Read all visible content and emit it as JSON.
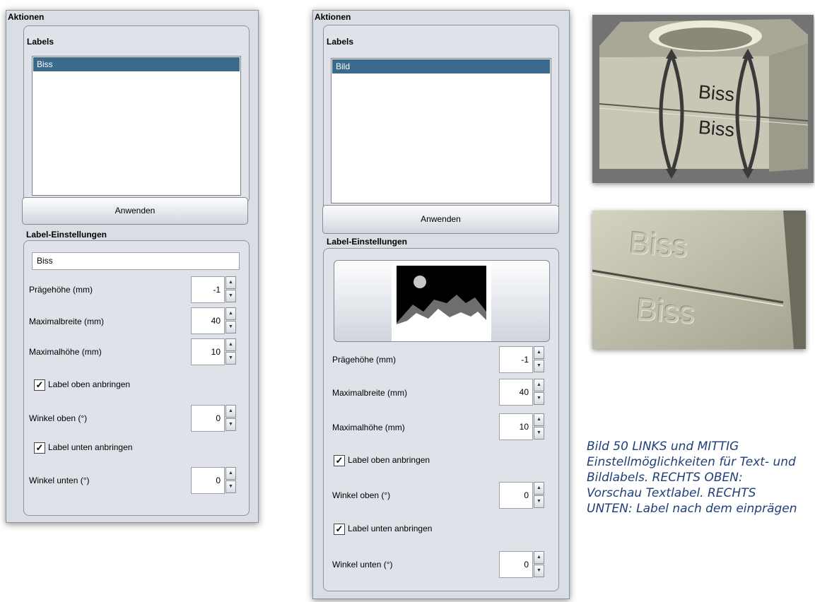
{
  "left_panel": {
    "title": "Aktionen",
    "labels_group_title": "Labels",
    "list_items": [
      "Biss"
    ],
    "apply_button": "Anwenden",
    "settings_title": "Label-Einstellungen",
    "text_value": "Biss",
    "emboss_height_label": "Prägehöhe (mm)",
    "emboss_height_value": "-1",
    "max_width_label": "Maximalbreite (mm)",
    "max_width_value": "40",
    "max_height_label": "Maximalhöhe (mm)",
    "max_height_value": "10",
    "label_top_checkbox": "Label oben anbringen",
    "angle_top_label": "Winkel oben (°)",
    "angle_top_value": "0",
    "label_bottom_checkbox": "Label unten anbringen",
    "angle_bottom_label": "Winkel unten (°)",
    "angle_bottom_value": "0"
  },
  "middle_panel": {
    "title": "Aktionen",
    "labels_group_title": "Labels",
    "list_items": [
      "Bild"
    ],
    "apply_button": "Anwenden",
    "settings_title": "Label-Einstellungen",
    "emboss_height_label": "Prägehöhe (mm)",
    "emboss_height_value": "-1",
    "max_width_label": "Maximalbreite (mm)",
    "max_width_value": "40",
    "max_height_label": "Maximalhöhe (mm)",
    "max_height_value": "10",
    "label_top_checkbox": "Label oben anbringen",
    "angle_top_label": "Winkel oben (°)",
    "angle_top_value": "0",
    "label_bottom_checkbox": "Label unten anbringen",
    "angle_bottom_label": "Winkel unten (°)",
    "angle_bottom_value": "0"
  },
  "preview_top": {
    "label_upper": "Biss",
    "label_lower": "Biss"
  },
  "preview_bottom": {
    "label_upper": "Biss",
    "label_lower": "Biss"
  },
  "caption": {
    "lines": [
      "Bild 50 LINKS und MITTIG",
      "Einstellmöglichkeiten für Text- und",
      "Bildlabels. RECHTS OBEN:",
      "Vorschau Textlabel. RECHTS",
      "UNTEN: Label nach dem einprägen"
    ]
  },
  "colors": {
    "selection": "#3a6a8c",
    "caption": "#1f3f7a",
    "panel_bg": "#d9dde4"
  }
}
